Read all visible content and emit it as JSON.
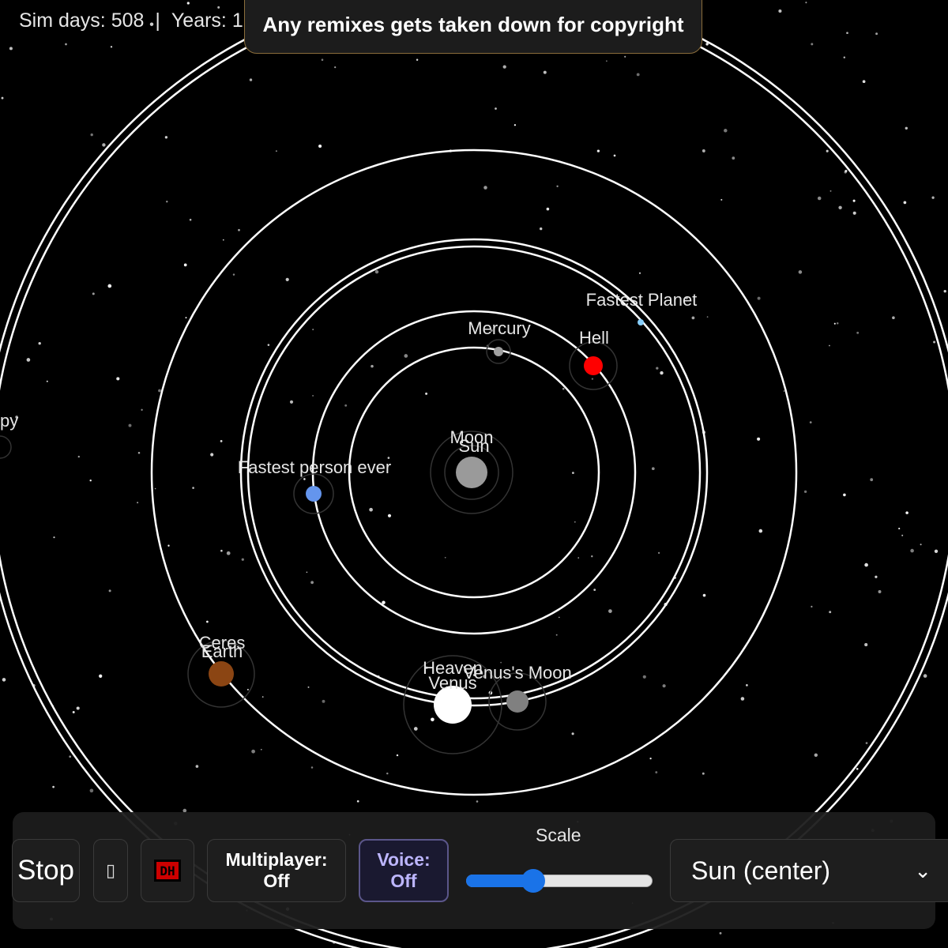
{
  "hud": {
    "sim_days": "Sim days: 508",
    "separator": "|",
    "years": "Years: 1"
  },
  "banner": {
    "text": "Any remixes gets taken down for copyright"
  },
  "bodies": {
    "moon": "Moon",
    "sun": "Sun",
    "mercury": "Mercury",
    "hell": "Hell",
    "fastest_planet": "Fastest Planet",
    "fastest_person": "Fastest person ever",
    "ceres": "Ceres",
    "earth": "Earth",
    "heaven": "Heaven",
    "venus": "Venus",
    "venus_moon": "Venus's Moon",
    "offscreen_partial": "py"
  },
  "colors": {
    "sun": "#9a9a9a",
    "mercury": "#a0a0a0",
    "hell": "#ff0000",
    "fastest_planet": "#87cefa",
    "fastest_person": "#6495ed",
    "earth": "#8b4513",
    "venus": "#ffffff",
    "venus_moon": "#808080",
    "accent": "#1a73e8"
  },
  "controls": {
    "stop": "Stop",
    "unknown_glyph": "▯",
    "icon_name": "red-box-icon",
    "icon_text": "DH",
    "multiplayer_line1": "Multiplayer:",
    "multiplayer_line2": "Off",
    "voice_line1": "Voice:",
    "voice_line2": "Off",
    "scale_label": "Scale",
    "scale_value": 0.36,
    "focus_selected": "Sun (center)"
  }
}
